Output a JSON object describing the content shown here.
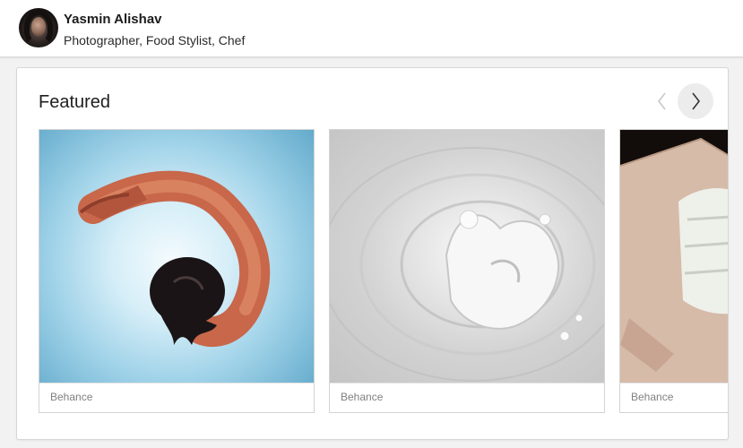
{
  "profile": {
    "name": "Yasmin Alishav",
    "subtitle": "Photographer, Food Stylist, Chef"
  },
  "featured": {
    "title": "Featured",
    "items": [
      {
        "caption": "Behance"
      },
      {
        "caption": "Behance"
      },
      {
        "caption": "Behance"
      }
    ]
  },
  "colors": {
    "page_bg": "#f2f2f2",
    "card_bg": "#ffffff",
    "caption_text": "#808080",
    "next_button_bg": "#ececec"
  },
  "icons": {
    "prev": "chevron-left-icon",
    "next": "chevron-right-icon"
  }
}
